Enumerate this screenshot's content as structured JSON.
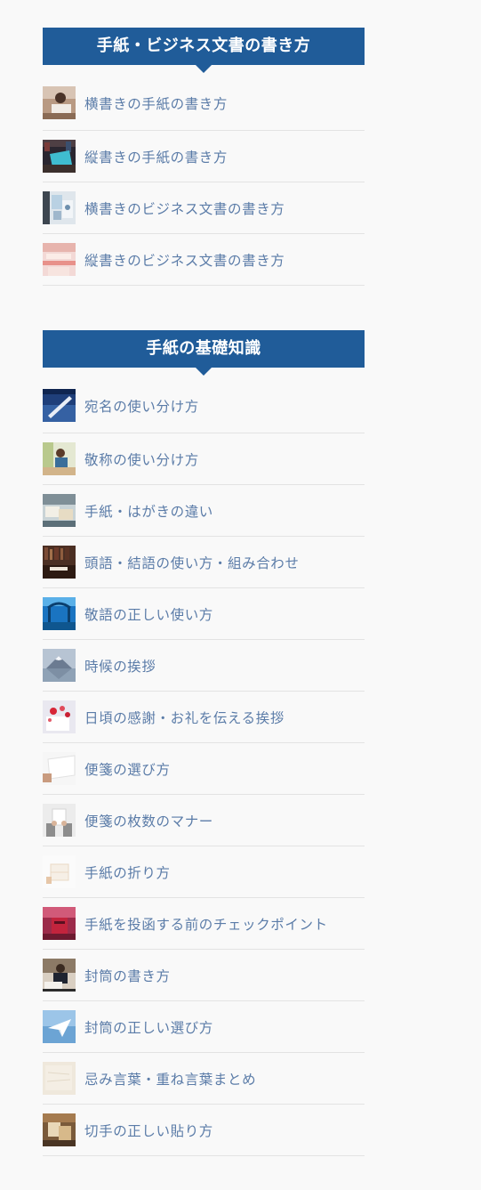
{
  "sections": [
    {
      "title": "手紙・ビジネス文書の書き方",
      "items": [
        {
          "label": "横書きの手紙の書き方",
          "thumb": "woman-writing-letter-image"
        },
        {
          "label": "縦書きの手紙の書き方",
          "thumb": "envelope-in-hand-image"
        },
        {
          "label": "横書きのビジネス文書の書き方",
          "thumb": "business-documents-image"
        },
        {
          "label": "縦書きのビジネス文書の書き方",
          "thumb": "pink-stationery-image"
        }
      ]
    },
    {
      "title": "手紙の基礎知識",
      "items": [
        {
          "label": "宛名の使い分け方",
          "thumb": "pen-writing-image"
        },
        {
          "label": "敬称の使い分け方",
          "thumb": "woman-at-desk-image"
        },
        {
          "label": "手紙・はがきの違い",
          "thumb": "postcards-image"
        },
        {
          "label": "頭語・結語の使い方・組み合わせ",
          "thumb": "bookshelf-desk-image"
        },
        {
          "label": "敬語の正しい使い方",
          "thumb": "blue-bridge-image"
        },
        {
          "label": "時候の挨拶",
          "thumb": "mount-fuji-image"
        },
        {
          "label": "日頃の感謝・お礼を伝える挨拶",
          "thumb": "red-petals-card-image"
        },
        {
          "label": "便箋の選び方",
          "thumb": "hand-holding-paper-image"
        },
        {
          "label": "便箋の枚数のマナー",
          "thumb": "hands-holding-letter-image"
        },
        {
          "label": "手紙の折り方",
          "thumb": "folded-letter-image"
        },
        {
          "label": "手紙を投函する前のチェックポイント",
          "thumb": "red-mailbox-image"
        },
        {
          "label": "封筒の書き方",
          "thumb": "man-writing-envelope-image"
        },
        {
          "label": "封筒の正しい選び方",
          "thumb": "paper-airplane-image"
        },
        {
          "label": "忌み言葉・重ね言葉まとめ",
          "thumb": "washi-paper-image"
        },
        {
          "label": "切手の正しい貼り方",
          "thumb": "stamps-image"
        }
      ]
    }
  ],
  "colors": {
    "header_bg": "#205c99",
    "link": "#5b7ca8",
    "divider": "#e3e3e3",
    "page_bg": "#f9f9f9"
  }
}
